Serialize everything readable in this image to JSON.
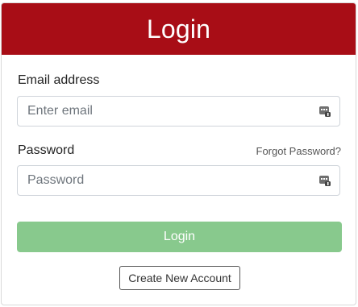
{
  "header": {
    "title": "Login"
  },
  "form": {
    "email_label": "Email address",
    "email_placeholder": "Enter email",
    "email_value": "",
    "password_label": "Password",
    "password_placeholder": "Password",
    "password_value": "",
    "forgot_password": "Forgot Password?",
    "login_button": "Login",
    "create_account_button": "Create New Account",
    "field_icon": "password-manager-icon"
  },
  "colors": {
    "header_bg": "#a80d16",
    "login_button_bg": "#88c98d"
  }
}
